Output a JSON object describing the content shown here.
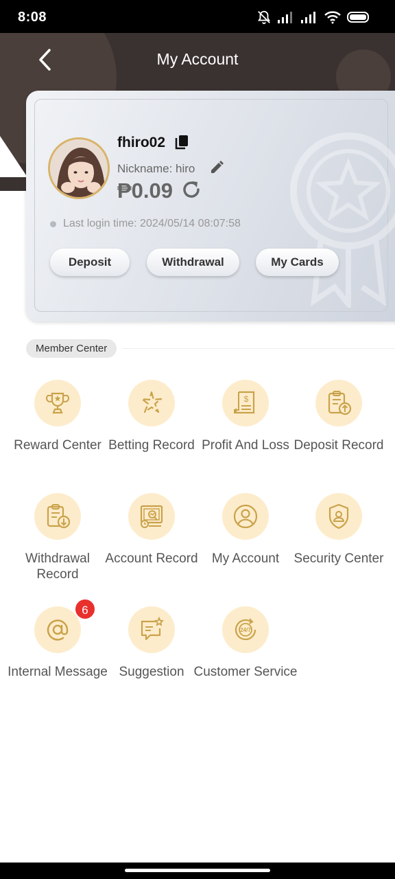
{
  "status_bar": {
    "time": "8:08"
  },
  "header": {
    "title": "My Account"
  },
  "account": {
    "username": "fhiro02",
    "nickname": "Nickname: hiro",
    "balance": "₱0.09",
    "last_login": "Last login time: 2024/05/14 08:07:58",
    "buttons": {
      "deposit": "Deposit",
      "withdrawal": "Withdrawal",
      "my_cards": "My Cards"
    }
  },
  "member_center": {
    "title": "Member Center",
    "items": [
      {
        "label": "Reward Center",
        "icon": "trophy-icon"
      },
      {
        "label": "Betting Record",
        "icon": "betting-icon"
      },
      {
        "label": "Profit And Loss",
        "icon": "document-dollar-icon"
      },
      {
        "label": "Deposit Record",
        "icon": "deposit-clipboard-icon"
      },
      {
        "label": "Withdrawal Record",
        "icon": "withdrawal-clipboard-icon"
      },
      {
        "label": "Account Record",
        "icon": "account-record-icon"
      },
      {
        "label": "My Account",
        "icon": "user-icon"
      },
      {
        "label": "Security Center",
        "icon": "shield-user-icon"
      },
      {
        "label": "Internal Message",
        "icon": "at-icon",
        "badge": "6"
      },
      {
        "label": "Suggestion",
        "icon": "chat-star-icon"
      },
      {
        "label": "Customer Service",
        "icon": "support-24-7-icon"
      }
    ]
  },
  "colors": {
    "accent_gold": "#c9a24a",
    "icon_bg": "#fdeccb",
    "header_bg": "#3a3230",
    "badge_red": "#e8302d"
  }
}
